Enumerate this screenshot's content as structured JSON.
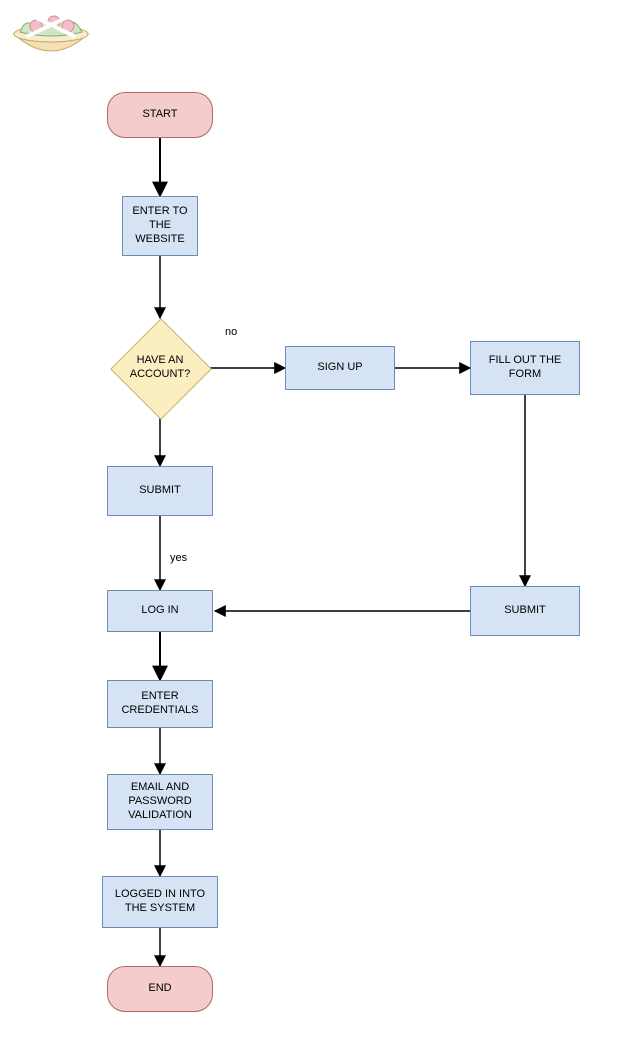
{
  "nodes": {
    "start": {
      "label": "START"
    },
    "enter_website": {
      "label": "ENTER TO THE WEBSITE"
    },
    "have_account": {
      "label": "HAVE AN ACCOUNT?"
    },
    "submit_left": {
      "label": "SUBMIT"
    },
    "log_in": {
      "label": "LOG IN"
    },
    "enter_credentials": {
      "label": "ENTER CREDENTIALS"
    },
    "validation": {
      "label": "EMAIL AND PASSWORD VALIDATION"
    },
    "logged_in": {
      "label": "LOGGED IN INTO THE SYSTEM"
    },
    "end": {
      "label": "END"
    },
    "sign_up": {
      "label": "SIGN UP"
    },
    "fill_form": {
      "label": "FILL OUT THE FORM"
    },
    "submit_right": {
      "label": "SUBMIT"
    }
  },
  "edge_labels": {
    "no": "no",
    "yes": "yes"
  }
}
